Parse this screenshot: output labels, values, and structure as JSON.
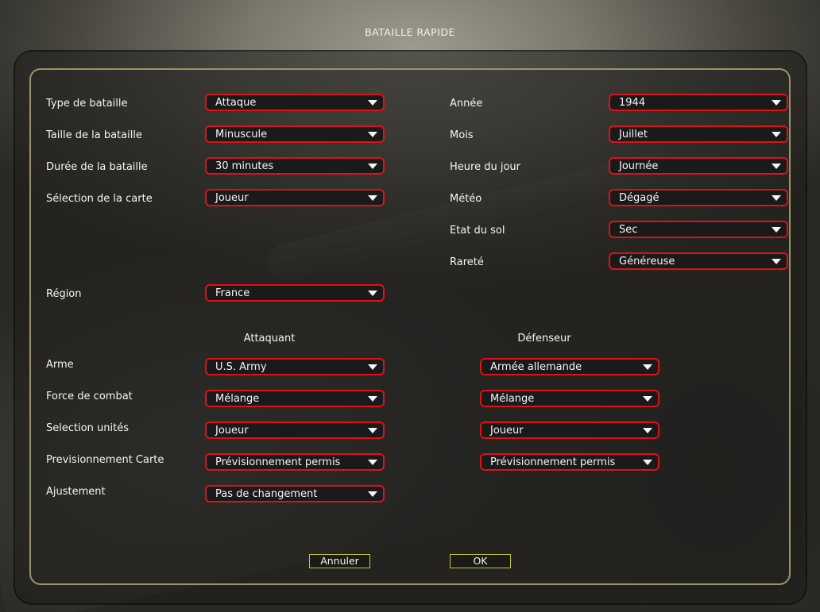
{
  "window": {
    "title": "BATAILLE RAPIDE"
  },
  "left": {
    "type": {
      "label": "Type de bataille",
      "value": "Attaque"
    },
    "size": {
      "label": "Taille de la bataille",
      "value": "Minuscule"
    },
    "duration": {
      "label": "Durée de la bataille",
      "value": "30 minutes"
    },
    "map": {
      "label": "Sélection de la carte",
      "value": "Joueur"
    },
    "region": {
      "label": "Région",
      "value": "France"
    }
  },
  "right": {
    "year": {
      "label": "Année",
      "value": "1944"
    },
    "month": {
      "label": "Mois",
      "value": "Juillet"
    },
    "time": {
      "label": "Heure du jour",
      "value": "Journée"
    },
    "weather": {
      "label": "Météo",
      "value": "Dégagé"
    },
    "ground": {
      "label": "Etat du sol",
      "value": "Sec"
    },
    "rarity": {
      "label": "Rareté",
      "value": "Généreuse"
    }
  },
  "forces": {
    "attacker_header": "Attaquant",
    "defender_header": "Défenseur",
    "rows": [
      {
        "label": "Arme",
        "attacker": "U.S. Army",
        "defender": "Armée allemande"
      },
      {
        "label": "Force de combat",
        "attacker": "Mélange",
        "defender": "Mélange"
      },
      {
        "label": "Selection unités",
        "attacker": "Joueur",
        "defender": "Joueur"
      },
      {
        "label": "Previsionnement Carte",
        "attacker": "Prévisionnement permis",
        "defender": "Prévisionnement permis"
      },
      {
        "label": "Ajustement",
        "attacker": "Pas de changement"
      }
    ]
  },
  "buttons": {
    "cancel": "Annuler",
    "ok": "OK"
  },
  "colors": {
    "dropdown_border": "#e0101a",
    "button_border": "#c7c23a",
    "panel_border": "#9a9468"
  },
  "icons": {
    "dropdown_caret": "caret-down-icon"
  }
}
